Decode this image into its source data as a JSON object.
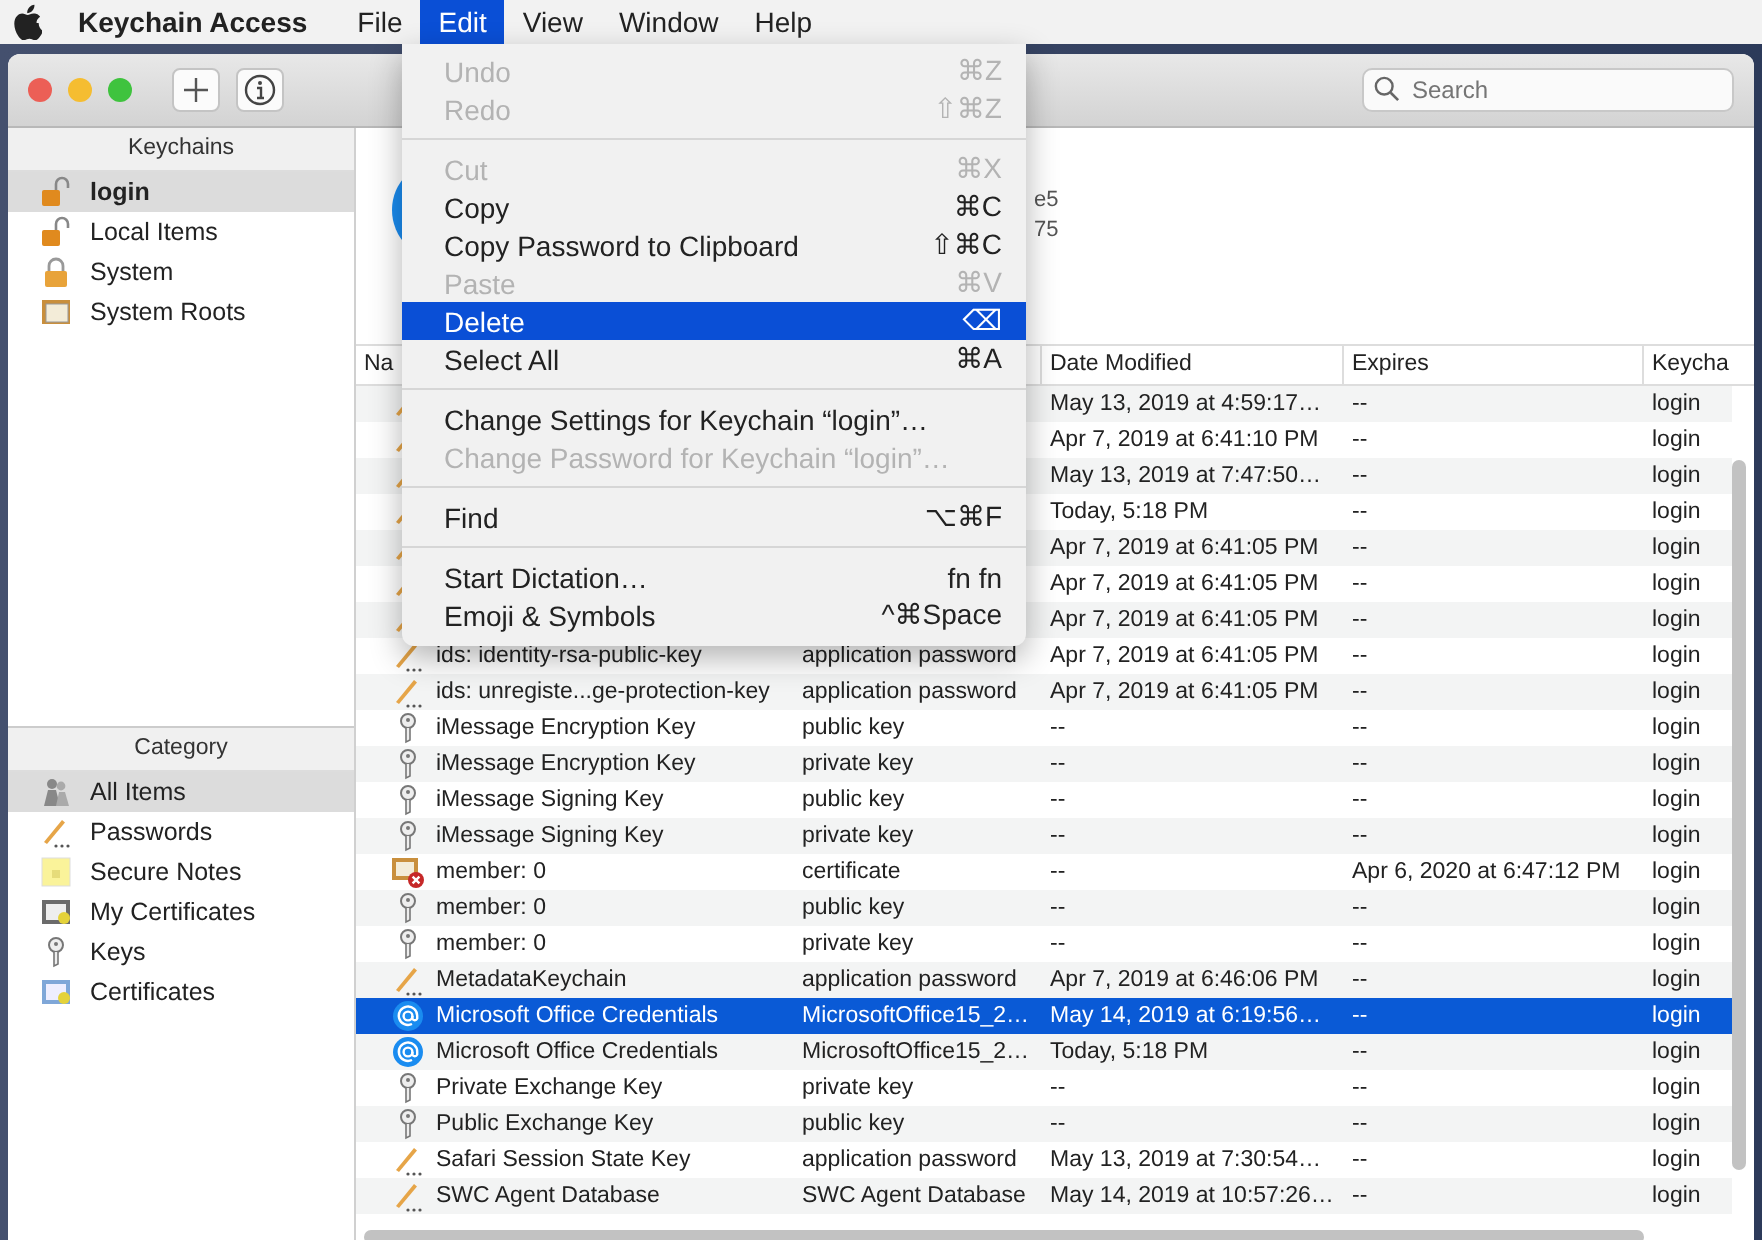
{
  "menu_bar": {
    "app_name": "Keychain Access",
    "menus": [
      {
        "label": "File",
        "selected": false
      },
      {
        "label": "Edit",
        "selected": true
      },
      {
        "label": "View",
        "selected": false
      },
      {
        "label": "Window",
        "selected": false
      },
      {
        "label": "Help",
        "selected": false
      }
    ]
  },
  "toolbar": {
    "search": {
      "placeholder": "Search"
    }
  },
  "sidebar": {
    "keychains": {
      "title": "Keychains",
      "items": [
        {
          "label": "login",
          "selected": true,
          "kind": "unlocked"
        },
        {
          "label": "Local Items",
          "selected": false,
          "kind": "unlocked"
        },
        {
          "label": "System",
          "selected": false,
          "kind": "locked"
        },
        {
          "label": "System Roots",
          "selected": false,
          "kind": "roots"
        }
      ]
    },
    "category": {
      "title": "Category",
      "items": [
        {
          "label": "All Items",
          "selected": true,
          "kind": "all"
        },
        {
          "label": "Passwords",
          "selected": false,
          "kind": "password"
        },
        {
          "label": "Secure Notes",
          "selected": false,
          "kind": "note"
        },
        {
          "label": "My Certificates",
          "selected": false,
          "kind": "identity"
        },
        {
          "label": "Keys",
          "selected": false,
          "kind": "key"
        },
        {
          "label": "Certificates",
          "selected": false,
          "kind": "certificate"
        }
      ]
    }
  },
  "preview": {
    "lines": [
      "e5",
      "75"
    ]
  },
  "table": {
    "columns": {
      "name": "Na",
      "date": "Date Modified",
      "expires": "Expires",
      "keychain": "Keycha"
    },
    "rows": [
      {
        "kind": "password",
        "date": "May 13, 2019 at 4:59:17…",
        "expires": "--",
        "keychain": "login",
        "selected": false
      },
      {
        "kind": "password",
        "date": "Apr 7, 2019 at 6:41:10 PM",
        "expires": "--",
        "keychain": "login",
        "selected": false
      },
      {
        "kind": "password",
        "date": "May 13, 2019 at 7:47:50…",
        "expires": "--",
        "keychain": "login",
        "selected": false
      },
      {
        "kind": "password",
        "date": "Today, 5:18 PM",
        "expires": "--",
        "keychain": "login",
        "selected": false
      },
      {
        "kind": "password",
        "date": "Apr 7, 2019 at 6:41:05 PM",
        "expires": "--",
        "keychain": "login",
        "selected": false
      },
      {
        "kind": "password",
        "date": "Apr 7, 2019 at 6:41:05 PM",
        "expires": "--",
        "keychain": "login",
        "selected": false
      },
      {
        "kind": "password",
        "date": "Apr 7, 2019 at 6:41:05 PM",
        "expires": "--",
        "keychain": "login",
        "selected": false
      },
      {
        "kind": "password",
        "name": "ids: identity-rsa-public-key",
        "column_2": "application password",
        "date": "Apr 7, 2019 at 6:41:05 PM",
        "expires": "--",
        "keychain": "login",
        "selected": false
      },
      {
        "kind": "password",
        "name": "ids: unregiste...ge-protection-key",
        "column_2": "application password",
        "date": "Apr 7, 2019 at 6:41:05 PM",
        "expires": "--",
        "keychain": "login",
        "selected": false
      },
      {
        "kind": "key",
        "name": "iMessage Encryption Key",
        "column_2": "public key",
        "date": "--",
        "expires": "--",
        "keychain": "login",
        "selected": false
      },
      {
        "kind": "key",
        "name": "iMessage Encryption Key",
        "column_2": "private key",
        "date": "--",
        "expires": "--",
        "keychain": "login",
        "selected": false
      },
      {
        "kind": "key",
        "name": "iMessage Signing Key",
        "column_2": "public key",
        "date": "--",
        "expires": "--",
        "keychain": "login",
        "selected": false
      },
      {
        "kind": "key",
        "name": "iMessage Signing Key",
        "column_2": "private key",
        "date": "--",
        "expires": "--",
        "keychain": "login",
        "selected": false
      },
      {
        "kind": "invalid",
        "name": "member: 0",
        "column_2": "certificate",
        "date": "--",
        "expires": "Apr 6, 2020 at 6:47:12 PM",
        "keychain": "login",
        "selected": false
      },
      {
        "kind": "key",
        "name": "member: 0",
        "column_2": "public key",
        "date": "--",
        "expires": "--",
        "keychain": "login",
        "selected": false
      },
      {
        "kind": "key",
        "name": "member: 0",
        "column_2": "private key",
        "date": "--",
        "expires": "--",
        "keychain": "login",
        "selected": false
      },
      {
        "kind": "password",
        "name": "MetadataKeychain",
        "column_2": "application password",
        "date": "Apr 7, 2019 at 6:46:06 PM",
        "expires": "--",
        "keychain": "login",
        "selected": false
      },
      {
        "kind": "internet",
        "name": "Microsoft Office Credentials",
        "column_2": "MicrosoftOffice15_2…",
        "date": "May 14, 2019 at 6:19:56…",
        "expires": "--",
        "keychain": "login",
        "selected": true
      },
      {
        "kind": "internet",
        "name": "Microsoft Office Credentials",
        "column_2": "MicrosoftOffice15_2…",
        "date": "Today, 5:18 PM",
        "expires": "--",
        "keychain": "login",
        "selected": false
      },
      {
        "kind": "key",
        "name": "Private Exchange Key",
        "column_2": "private key",
        "date": "--",
        "expires": "--",
        "keychain": "login",
        "selected": false
      },
      {
        "kind": "key",
        "name": "Public Exchange Key",
        "column_2": "public key",
        "date": "--",
        "expires": "--",
        "keychain": "login",
        "selected": false
      },
      {
        "kind": "password",
        "name": "Safari Session State Key",
        "column_2": "application password",
        "date": "May 13, 2019 at 7:30:54…",
        "expires": "--",
        "keychain": "login",
        "selected": false
      },
      {
        "kind": "password",
        "name": "SWC Agent Database",
        "column_2": "SWC Agent Database",
        "date": "May 14, 2019 at 10:57:26…",
        "expires": "--",
        "keychain": "login",
        "selected": false
      }
    ]
  },
  "edit_menu": {
    "items": [
      {
        "kind": "item",
        "label": "Undo",
        "shortcut": "⌘Z",
        "disabled": true,
        "selected": false
      },
      {
        "kind": "item",
        "label": "Redo",
        "shortcut": "⇧⌘Z",
        "disabled": true,
        "selected": false
      },
      {
        "kind": "separator"
      },
      {
        "kind": "item",
        "label": "Cut",
        "shortcut": "⌘X",
        "disabled": true,
        "selected": false
      },
      {
        "kind": "item",
        "label": "Copy",
        "shortcut": "⌘C",
        "disabled": false,
        "selected": false
      },
      {
        "kind": "item",
        "label": "Copy Password to Clipboard",
        "shortcut": "⇧⌘C",
        "disabled": false,
        "selected": false
      },
      {
        "kind": "item",
        "label": "Paste",
        "shortcut": "⌘V",
        "disabled": true,
        "selected": false
      },
      {
        "kind": "item",
        "label": "Delete",
        "shortcut": "⌫",
        "disabled": false,
        "selected": true
      },
      {
        "kind": "item",
        "label": "Select All",
        "shortcut": "⌘A",
        "disabled": false,
        "selected": false
      },
      {
        "kind": "separator"
      },
      {
        "kind": "item",
        "label": "Change Settings for Keychain “login”…",
        "disabled": false,
        "selected": false
      },
      {
        "kind": "item",
        "label": "Change Password for Keychain “login”…",
        "disabled": true,
        "selected": false
      },
      {
        "kind": "separator"
      },
      {
        "kind": "item",
        "label": "Find",
        "shortcut": "⌥⌘F",
        "disabled": false,
        "selected": false
      },
      {
        "kind": "separator"
      },
      {
        "kind": "item",
        "label": "Start Dictation…",
        "shortcut": "fn fn",
        "disabled": false,
        "selected": false
      },
      {
        "kind": "item",
        "label": "Emoji & Symbols",
        "shortcut": "^⌘Space",
        "disabled": false,
        "selected": false
      }
    ]
  }
}
